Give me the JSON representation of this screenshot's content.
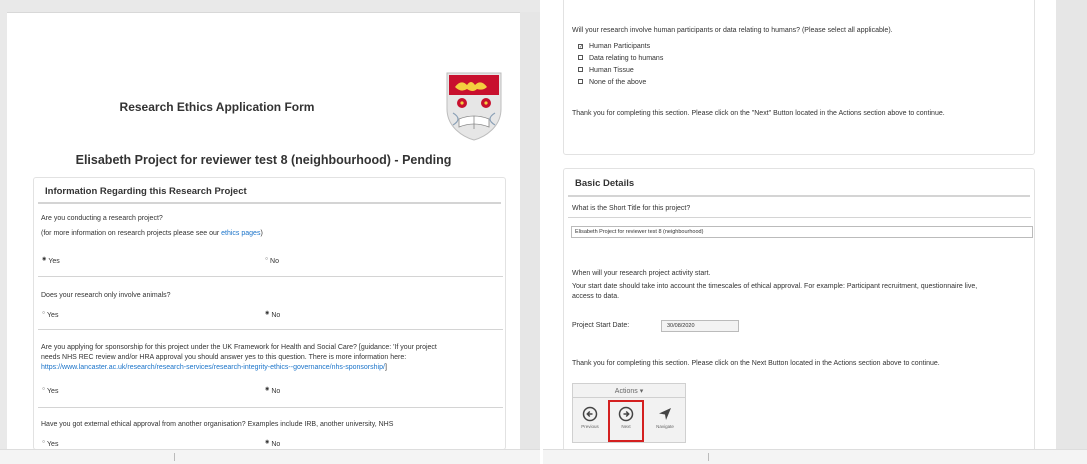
{
  "left": {
    "form_title": "Research Ethics Application Form",
    "project_title": "Elisabeth Project for reviewer test 8 (neighbourhood) - Pending",
    "section_title": "Information Regarding this Research Project",
    "q1": "Are you conducting a research project?",
    "q1_note_prefix": "(for more information on research projects please see our ",
    "q1_note_link": "ethics pages",
    "q1_note_suffix": ")",
    "q1_answer": "Yes",
    "q2": "Does your research only involve animals?",
    "q2_answer": "No",
    "q3_line1": "Are you applying for sponsorship for this project under the UK Framework for Health and Social Care? [guidance: 'If your project",
    "q3_line2": "needs NHS REC review and/or HRA approval you should answer yes to this question. There is more information here:",
    "q3_link": "https://www.lancaster.ac.uk/research/research-services/research-integrity-ethics--governance/nhs-sponsorship/",
    "q3_link_suffix": "]",
    "q3_answer": "No",
    "q4": "Have you got external ethical approval from another organisation? Examples include IRB, another university, NHS",
    "q4_answer": "No",
    "yes_label": "Yes",
    "no_label": "No"
  },
  "right": {
    "participants_question": "Will your research involve human participants or data relating to humans? (Please select all applicable).",
    "checkboxes": [
      {
        "label": "Human Participants",
        "checked": true
      },
      {
        "label": "Data relating to humans",
        "checked": false
      },
      {
        "label": "Human Tissue",
        "checked": false
      },
      {
        "label": "None of the above",
        "checked": false
      }
    ],
    "thanks_1": "Thank you for completing this section. Please click on the \"Next\" Button located in the Actions section above to continue.",
    "basic_title": "Basic Details",
    "short_title_q": "What is the Short Title for this project?",
    "short_title_value": "Elisabeth Project for reviewer test 8 (neighbourhood)",
    "start_q": "When will your research project activity start.",
    "start_note_line1": "Your start date should take into account the timescales of ethical approval. For example: Participant recruitment, questionnaire live,",
    "start_note_line2": "access to data.",
    "start_date_label": "Project Start Date:",
    "start_date_value": "30/08/2020",
    "thanks_2": "Thank you for completing this section. Please click on the Next Button located in the Actions section above to continue.",
    "actions_label": "Actions",
    "previous_label": "Previous",
    "next_label": "Next",
    "navigate_label": "Navigate"
  },
  "colors": {
    "link": "#1a73c9",
    "highlight": "#d42020",
    "crest_red": "#c8102e"
  }
}
